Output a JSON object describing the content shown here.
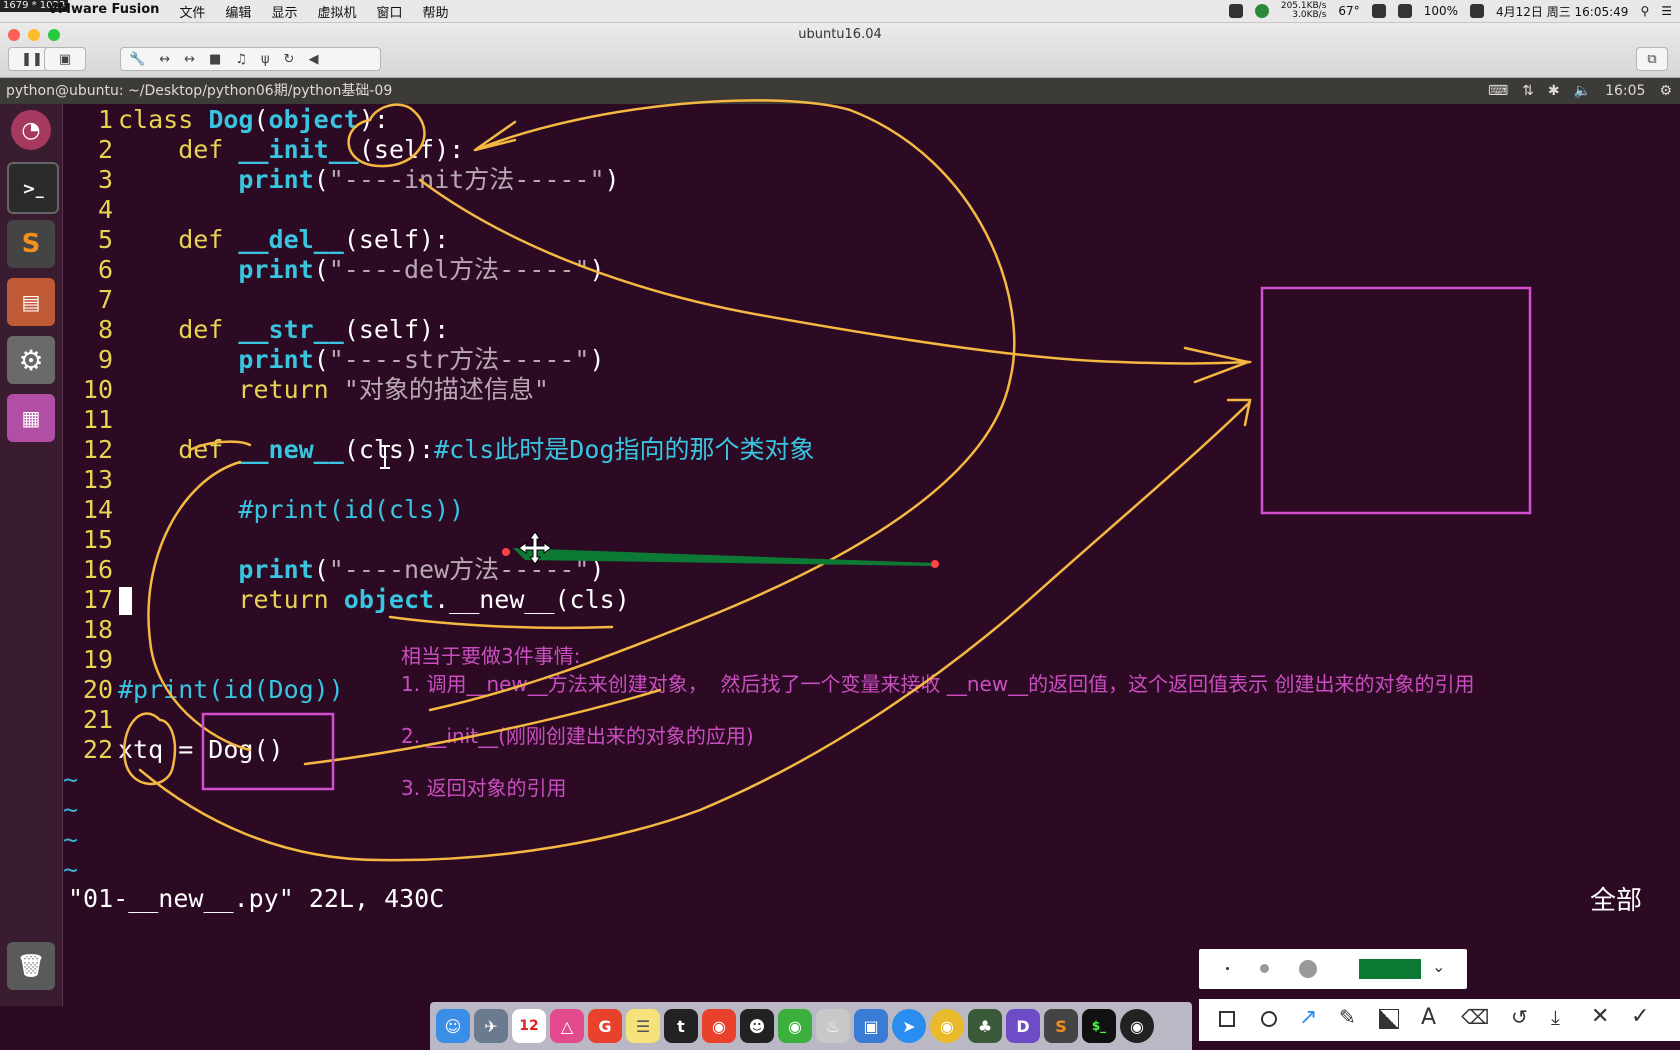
{
  "mac_menubar": {
    "resolution": "1679 * 1023",
    "app_name": "VMware Fusion",
    "menus": [
      "文件",
      "编辑",
      "显示",
      "虚拟机",
      "窗口",
      "帮助"
    ],
    "net_up": "205.1KB/s",
    "net_down": "3.0KB/s",
    "temp": "67°",
    "battery": "100%",
    "datetime": "4月12日 周三 16:05:49"
  },
  "vm_window": {
    "title": "ubuntu16.04"
  },
  "ubuntu_panel": {
    "path": "python@ubuntu: ~/Desktop/python06期/python基础-09",
    "time": "16:05"
  },
  "editor": {
    "lines": [
      {
        "n": "1"
      },
      {
        "n": "2"
      },
      {
        "n": "3"
      },
      {
        "n": "4"
      },
      {
        "n": "5"
      },
      {
        "n": "6"
      },
      {
        "n": "7"
      },
      {
        "n": "8"
      },
      {
        "n": "9"
      },
      {
        "n": "10"
      },
      {
        "n": "11"
      },
      {
        "n": "12"
      },
      {
        "n": "13"
      },
      {
        "n": "14"
      },
      {
        "n": "15"
      },
      {
        "n": "16"
      },
      {
        "n": "17"
      },
      {
        "n": "18"
      },
      {
        "n": "19"
      },
      {
        "n": "20"
      },
      {
        "n": "21"
      },
      {
        "n": "22"
      }
    ],
    "code": {
      "l1a": "class ",
      "l1b": "Dog",
      "l1c": "(",
      "l1d": "object",
      "l1e": "):",
      "l2a": "    def ",
      "l2b": "__init__",
      "l2c": "(self):",
      "l3a": "        ",
      "l3b": "print",
      "l3c": "(",
      "l3d": "\"----init方法-----\"",
      "l3e": ")",
      "l5a": "    def ",
      "l5b": "__del__",
      "l5c": "(self):",
      "l6a": "        ",
      "l6b": "print",
      "l6c": "(",
      "l6d": "\"----del方法-----\"",
      "l6e": ")",
      "l8a": "    def ",
      "l8b": "__str__",
      "l8c": "(self):",
      "l9a": "        ",
      "l9b": "print",
      "l9c": "(",
      "l9d": "\"----str方法-----\"",
      "l9e": ")",
      "l10a": "        return ",
      "l10b": "\"对象的描述信息\"",
      "l12a": "    def ",
      "l12b": "__new__",
      "l12c": "(cls):",
      "l12d": "#cls此时是Dog指向的那个类对象",
      "l14a": "        ",
      "l14b": "#print(id(cls))",
      "l16a": "        ",
      "l16b": "print",
      "l16c": "(",
      "l16d": "\"----new方法-----\"",
      "l16e": ")",
      "l17a": "        return ",
      "l17b": "object",
      "l17c": ".__new__(cls)",
      "l20a": "#print(id(Dog))",
      "l22a": "xtq = Dog()"
    },
    "tilde": "~",
    "status": "\"01-__new__.py\" 22L, 430C",
    "position": "全部"
  },
  "notes": {
    "title": "相当于要做3件事情:",
    "item1": "1. 调用__new__方法来创建对象，  然后找了一个变量来接收 __new__的返回值，这个返回值表示 创建出来的对象的引用",
    "item2": "2. __init__(刚刚创建出来的对象的应用)",
    "item3": "3. 返回对象的引用"
  },
  "colors": {
    "annotation_pen": "#f5b942",
    "annotation_box": "#d24fd0",
    "arrow_green": "#0c7a35"
  }
}
